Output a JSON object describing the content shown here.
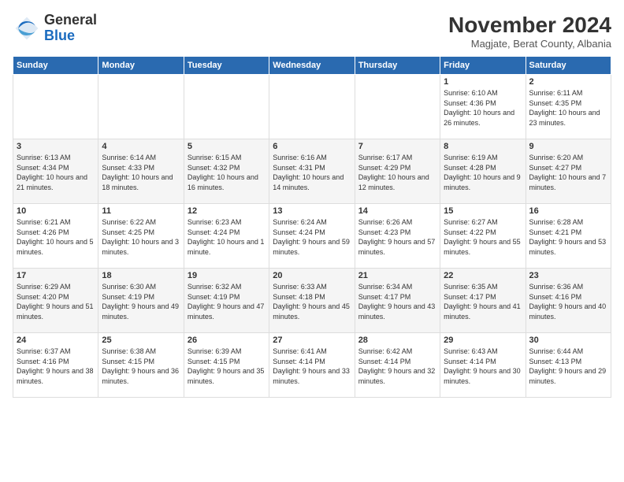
{
  "header": {
    "logo_general": "General",
    "logo_blue": "Blue",
    "month_title": "November 2024",
    "subtitle": "Magjate, Berat County, Albania"
  },
  "days_of_week": [
    "Sunday",
    "Monday",
    "Tuesday",
    "Wednesday",
    "Thursday",
    "Friday",
    "Saturday"
  ],
  "weeks": [
    [
      {
        "num": "",
        "info": ""
      },
      {
        "num": "",
        "info": ""
      },
      {
        "num": "",
        "info": ""
      },
      {
        "num": "",
        "info": ""
      },
      {
        "num": "",
        "info": ""
      },
      {
        "num": "1",
        "info": "Sunrise: 6:10 AM\nSunset: 4:36 PM\nDaylight: 10 hours and 26 minutes."
      },
      {
        "num": "2",
        "info": "Sunrise: 6:11 AM\nSunset: 4:35 PM\nDaylight: 10 hours and 23 minutes."
      }
    ],
    [
      {
        "num": "3",
        "info": "Sunrise: 6:13 AM\nSunset: 4:34 PM\nDaylight: 10 hours and 21 minutes."
      },
      {
        "num": "4",
        "info": "Sunrise: 6:14 AM\nSunset: 4:33 PM\nDaylight: 10 hours and 18 minutes."
      },
      {
        "num": "5",
        "info": "Sunrise: 6:15 AM\nSunset: 4:32 PM\nDaylight: 10 hours and 16 minutes."
      },
      {
        "num": "6",
        "info": "Sunrise: 6:16 AM\nSunset: 4:31 PM\nDaylight: 10 hours and 14 minutes."
      },
      {
        "num": "7",
        "info": "Sunrise: 6:17 AM\nSunset: 4:29 PM\nDaylight: 10 hours and 12 minutes."
      },
      {
        "num": "8",
        "info": "Sunrise: 6:19 AM\nSunset: 4:28 PM\nDaylight: 10 hours and 9 minutes."
      },
      {
        "num": "9",
        "info": "Sunrise: 6:20 AM\nSunset: 4:27 PM\nDaylight: 10 hours and 7 minutes."
      }
    ],
    [
      {
        "num": "10",
        "info": "Sunrise: 6:21 AM\nSunset: 4:26 PM\nDaylight: 10 hours and 5 minutes."
      },
      {
        "num": "11",
        "info": "Sunrise: 6:22 AM\nSunset: 4:25 PM\nDaylight: 10 hours and 3 minutes."
      },
      {
        "num": "12",
        "info": "Sunrise: 6:23 AM\nSunset: 4:24 PM\nDaylight: 10 hours and 1 minute."
      },
      {
        "num": "13",
        "info": "Sunrise: 6:24 AM\nSunset: 4:24 PM\nDaylight: 9 hours and 59 minutes."
      },
      {
        "num": "14",
        "info": "Sunrise: 6:26 AM\nSunset: 4:23 PM\nDaylight: 9 hours and 57 minutes."
      },
      {
        "num": "15",
        "info": "Sunrise: 6:27 AM\nSunset: 4:22 PM\nDaylight: 9 hours and 55 minutes."
      },
      {
        "num": "16",
        "info": "Sunrise: 6:28 AM\nSunset: 4:21 PM\nDaylight: 9 hours and 53 minutes."
      }
    ],
    [
      {
        "num": "17",
        "info": "Sunrise: 6:29 AM\nSunset: 4:20 PM\nDaylight: 9 hours and 51 minutes."
      },
      {
        "num": "18",
        "info": "Sunrise: 6:30 AM\nSunset: 4:19 PM\nDaylight: 9 hours and 49 minutes."
      },
      {
        "num": "19",
        "info": "Sunrise: 6:32 AM\nSunset: 4:19 PM\nDaylight: 9 hours and 47 minutes."
      },
      {
        "num": "20",
        "info": "Sunrise: 6:33 AM\nSunset: 4:18 PM\nDaylight: 9 hours and 45 minutes."
      },
      {
        "num": "21",
        "info": "Sunrise: 6:34 AM\nSunset: 4:17 PM\nDaylight: 9 hours and 43 minutes."
      },
      {
        "num": "22",
        "info": "Sunrise: 6:35 AM\nSunset: 4:17 PM\nDaylight: 9 hours and 41 minutes."
      },
      {
        "num": "23",
        "info": "Sunrise: 6:36 AM\nSunset: 4:16 PM\nDaylight: 9 hours and 40 minutes."
      }
    ],
    [
      {
        "num": "24",
        "info": "Sunrise: 6:37 AM\nSunset: 4:16 PM\nDaylight: 9 hours and 38 minutes."
      },
      {
        "num": "25",
        "info": "Sunrise: 6:38 AM\nSunset: 4:15 PM\nDaylight: 9 hours and 36 minutes."
      },
      {
        "num": "26",
        "info": "Sunrise: 6:39 AM\nSunset: 4:15 PM\nDaylight: 9 hours and 35 minutes."
      },
      {
        "num": "27",
        "info": "Sunrise: 6:41 AM\nSunset: 4:14 PM\nDaylight: 9 hours and 33 minutes."
      },
      {
        "num": "28",
        "info": "Sunrise: 6:42 AM\nSunset: 4:14 PM\nDaylight: 9 hours and 32 minutes."
      },
      {
        "num": "29",
        "info": "Sunrise: 6:43 AM\nSunset: 4:14 PM\nDaylight: 9 hours and 30 minutes."
      },
      {
        "num": "30",
        "info": "Sunrise: 6:44 AM\nSunset: 4:13 PM\nDaylight: 9 hours and 29 minutes."
      }
    ]
  ]
}
